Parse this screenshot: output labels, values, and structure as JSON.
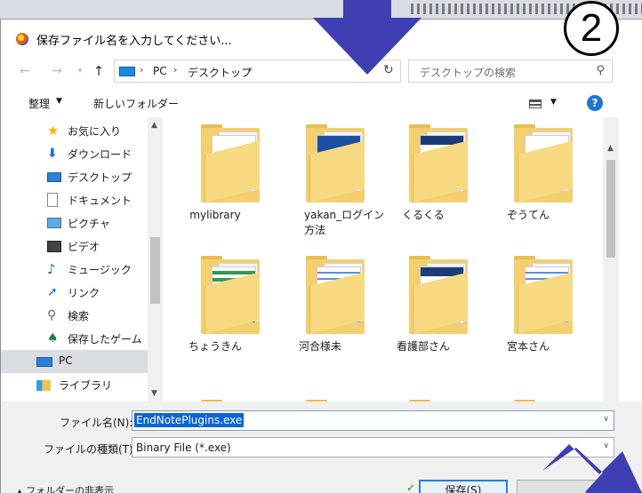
{
  "step_number": "2",
  "dialog": {
    "title": "保存ファイル名を入力してください..."
  },
  "address_bar": {
    "crumbs": [
      "PC",
      "デスクトップ"
    ],
    "separator": "›"
  },
  "search": {
    "placeholder": "デスクトップの検索"
  },
  "toolbar": {
    "organize": "整理",
    "new_folder": "新しいフォルダー",
    "help": "?"
  },
  "sidebar": {
    "items": [
      {
        "label": "お気に入り",
        "icon": "star-icon"
      },
      {
        "label": "ダウンロード",
        "icon": "download-icon"
      },
      {
        "label": "デスクトップ",
        "icon": "desktop-icon"
      },
      {
        "label": "ドキュメント",
        "icon": "document-icon"
      },
      {
        "label": "ピクチャ",
        "icon": "pictures-icon"
      },
      {
        "label": "ビデオ",
        "icon": "video-icon"
      },
      {
        "label": "ミュージック",
        "icon": "music-icon"
      },
      {
        "label": "リンク",
        "icon": "link-icon"
      },
      {
        "label": "検索",
        "icon": "search-icon"
      },
      {
        "label": "保存したゲーム",
        "icon": "game-icon"
      },
      {
        "label": "PC",
        "icon": "pc-icon",
        "selected": true
      },
      {
        "label": "ライブラリ",
        "icon": "library-icon"
      }
    ]
  },
  "files": [
    {
      "name": "mylibrary",
      "style": "plain"
    },
    {
      "name": "yakan_ログイン方法",
      "style": "dark"
    },
    {
      "name": "くるくる",
      "style": "web"
    },
    {
      "name": "ぞうてん",
      "style": "plain"
    },
    {
      "name": "ちょうきん",
      "style": "green"
    },
    {
      "name": "河合様未",
      "style": "blue"
    },
    {
      "name": "看護部さん",
      "style": "web"
    },
    {
      "name": "宮本さん",
      "style": "blue"
    },
    {
      "name": "",
      "style": "red"
    },
    {
      "name": "",
      "style": "plain"
    },
    {
      "name": "",
      "style": "plain"
    },
    {
      "name": "",
      "style": "green"
    }
  ],
  "form": {
    "filename_label": "ファイル名(N):",
    "filename_value": "EndNotePlugins.exe",
    "filetype_label": "ファイルの種類(T):",
    "filetype_value": "Binary File (*.exe)",
    "hide_folders": "フォルダーの非表示",
    "save_label": "保存(S)"
  },
  "colors": {
    "arrow": "#3f3fb2",
    "selection": "#0a64d7",
    "folder": "#f4cf70"
  }
}
